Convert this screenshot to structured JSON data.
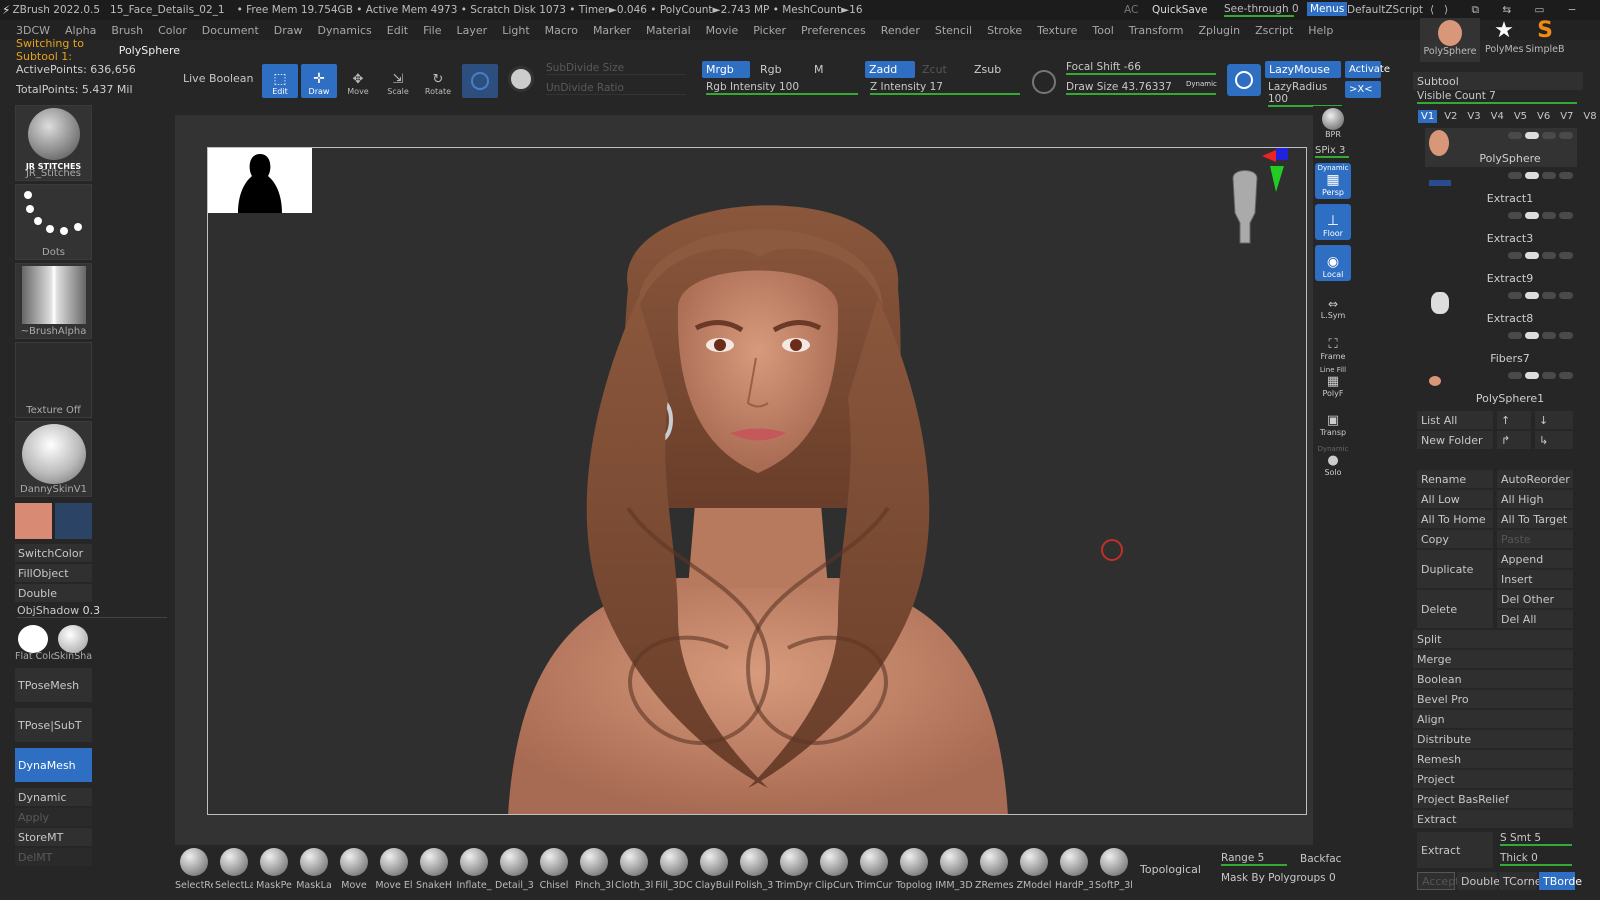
{
  "title": {
    "app": "ZBrush 2022.0.5",
    "file": "15_Face_Details_02_1",
    "stats": "• Free Mem 19.754GB • Active Mem 4973 • Scratch Disk 1073 • Timer►0.046 • PolyCount►2.743 MP • MeshCount►16",
    "ac": "AC",
    "quicksave": "QuickSave",
    "seethrough": "See-through  0",
    "menus": "Menus",
    "script": "DefaultZScript"
  },
  "menubar": [
    "3DCW",
    "Alpha",
    "Brush",
    "Color",
    "Document",
    "Draw",
    "Dynamics",
    "Edit",
    "File",
    "Layer",
    "Light",
    "Macro",
    "Marker",
    "Material",
    "Movie",
    "Picker",
    "Preferences",
    "Render",
    "Stencil",
    "Stroke",
    "Texture",
    "Tool",
    "Transform",
    "Zplugin",
    "Zscript",
    "Help"
  ],
  "notice": {
    "prefix": "Switching to Subtool 1:",
    "name": "PolySphere"
  },
  "left": {
    "active_points": "ActivePoints: 636,656",
    "total_points": "TotalPoints: 5.437 Mil",
    "brush_label": "JR_Stitches",
    "brush_text": "JR STITCHES",
    "stroke_label": "Dots",
    "alpha_label": "~BrushAlpha",
    "texture_label": "Texture Off",
    "material_label": "DannySkinV1",
    "switchcolor": "SwitchColor",
    "fillobject": "FillObject",
    "double": "Double",
    "objshadow": "ObjShadow",
    "objshadow_val": "0.3",
    "mat1": "Flat Colc",
    "mat2": "SkinSha",
    "tposemesh": "TPoseMesh",
    "tposesubt": "TPose|SubT",
    "dynamesh": "DynaMesh",
    "dynamic": "Dynamic",
    "apply": "Apply",
    "storemt": "StoreMT",
    "delmt": "DelMT"
  },
  "shelf": {
    "live_boolean": "Live Boolean",
    "edit": "Edit",
    "draw": "Draw",
    "move": "Move",
    "scale": "Scale",
    "rotate": "Rotate",
    "subdivide": "SubDivide Size",
    "undivide": "UnDivide Ratio",
    "mrgb": "Mrgb",
    "rgb": "Rgb",
    "m": "M",
    "rgb_intensity": "Rgb Intensity 100",
    "zadd": "Zadd",
    "zcut": "Zcut",
    "zsub": "Zsub",
    "z_intensity": "Z Intensity 17",
    "focal_shift": "Focal Shift -66",
    "draw_size": "Draw Size 43.76337",
    "dynamic": "Dynamic",
    "lazymouse": "LazyMouse",
    "lazyradius": "LazyRadius 100",
    "activate": "Activate",
    "xc": ">X<"
  },
  "rightstrip": {
    "bpr": "BPR",
    "spix": "SPix 3",
    "persp": "Persp",
    "persp_tag": "Dynamic",
    "floor": "Floor",
    "local": "Local",
    "lsym": "L.Sym",
    "frame": "Frame",
    "polyf": "PolyF",
    "polyf_tag": "Line Fill",
    "transp": "Transp",
    "solo": "Solo",
    "solo_tag": "Dynamic"
  },
  "bottom": {
    "brushes": [
      "SelectRe",
      "SelectLa",
      "MaskPe",
      "MaskLa",
      "Move",
      "Move El",
      "SnakeH",
      "Inflate_",
      "Detail_3",
      "Chisel",
      "Pinch_3l",
      "Cloth_3l",
      "Fill_3DC",
      "ClayBuil",
      "Polish_3",
      "TrimDyr",
      "ClipCurv",
      "TrimCur",
      "Topolog",
      "IMM_3D",
      "ZRemes",
      "ZModel",
      "HardP_3",
      "SoftP_3l"
    ],
    "topological": "Topological",
    "range": "Range 5",
    "backface": "Backfac",
    "mask_by_polygroups": "Mask By Polygroups 0"
  },
  "right": {
    "tools": [
      "PolySphere",
      "PolyMes",
      "SimpleB"
    ],
    "subtool": "Subtool",
    "visible_count": "Visible Count 7",
    "versions": [
      "V1",
      "V2",
      "V3",
      "V4",
      "V5",
      "V6",
      "V7",
      "V8"
    ],
    "subtools": [
      "PolySphere",
      "Extract1",
      "Extract3",
      "Extract9",
      "Extract8",
      "Fibers7",
      "PolySphere1"
    ],
    "list_all": "List All",
    "new_folder": "New Folder",
    "rename": "Rename",
    "autoreorder": "AutoReorder",
    "all_low": "All Low",
    "all_high": "All High",
    "all_to_home": "All To Home",
    "all_to_target": "All To Target",
    "copy": "Copy",
    "paste": "Paste",
    "duplicate": "Duplicate",
    "append": "Append",
    "insert": "Insert",
    "delete": "Delete",
    "del_other": "Del Other",
    "del_all": "Del All",
    "split": "Split",
    "merge": "Merge",
    "boolean": "Boolean",
    "bevel_pro": "Bevel Pro",
    "align": "Align",
    "distribute": "Distribute",
    "remesh": "Remesh",
    "project": "Project",
    "project_basrelief": "Project BasRelief",
    "extract_header": "Extract",
    "extract_btn": "Extract",
    "s_smt": "S Smt 5",
    "thick": "Thick 0",
    "accept": "Accept",
    "double": "Double",
    "tcorne": "TCorne",
    "tborde": "TBorde"
  },
  "colors": {
    "accent": "#2e6fc4",
    "primary_color": "#d98a75",
    "secondary_color": "#2b4466",
    "hair": "#7a4a32",
    "skin": "#c98a6e"
  }
}
